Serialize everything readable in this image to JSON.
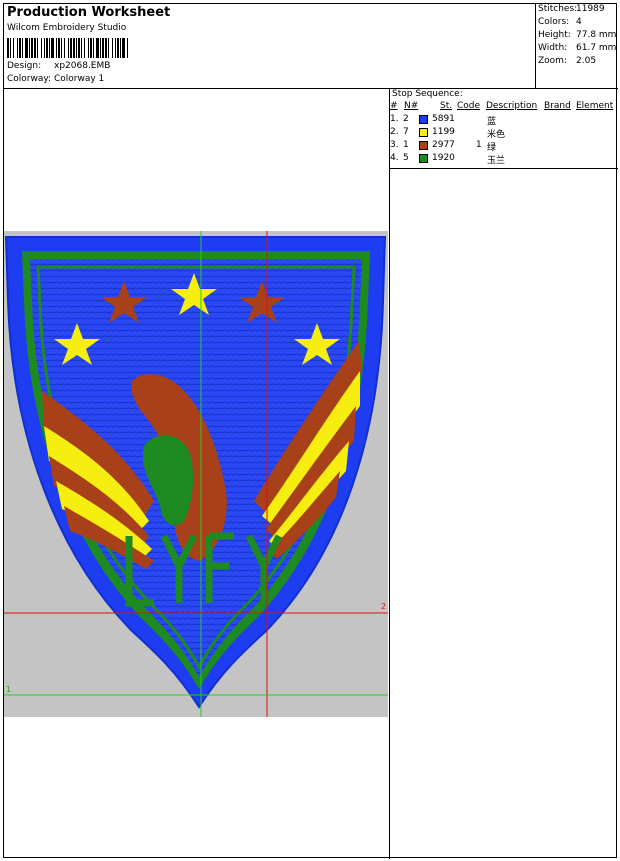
{
  "header": {
    "title": "Production Worksheet",
    "software": "Wilcom Embroidery Studio",
    "design_label": "Design:",
    "design_value": "xp2068.EMB",
    "colorway_label": "Colorway:",
    "colorway_value": "Colorway 1"
  },
  "stats": [
    {
      "label": "Stitches:",
      "value": "11989"
    },
    {
      "label": "Colors:",
      "value": "4"
    },
    {
      "label": "Height:",
      "value": "77.8 mm"
    },
    {
      "label": "Width:",
      "value": "61.7 mm"
    },
    {
      "label": "Zoom:",
      "value": "2.05"
    }
  ],
  "stop_sequence": {
    "title": "Stop Sequence:",
    "columns": [
      "#",
      "N#",
      "St.",
      "Code",
      "Description",
      "Brand",
      "Element"
    ],
    "rows": [
      {
        "num": "1.",
        "n": "2",
        "color": "#1e3cf0",
        "st": "5891",
        "code": "",
        "desc": "蓝"
      },
      {
        "num": "2.",
        "n": "7",
        "color": "#f5ee10",
        "st": "1199",
        "code": "",
        "desc": "米色"
      },
      {
        "num": "3.",
        "n": "1",
        "color": "#a8401a",
        "st": "2977",
        "code": "1",
        "desc": "绿"
      },
      {
        "num": "4.",
        "n": "5",
        "color": "#1e8a22",
        "st": "1920",
        "code": "",
        "desc": "玉兰"
      }
    ]
  },
  "canvas": {
    "label_x_axis": "2",
    "label_y_axis": "1",
    "colors": {
      "background": "#c4c4c4",
      "blue": "#1e3cf0",
      "yellow": "#f5ee10",
      "brown": "#a8401a",
      "green": "#1e8a22",
      "guide_red": "#e01010",
      "guide_green": "#20d020"
    }
  }
}
